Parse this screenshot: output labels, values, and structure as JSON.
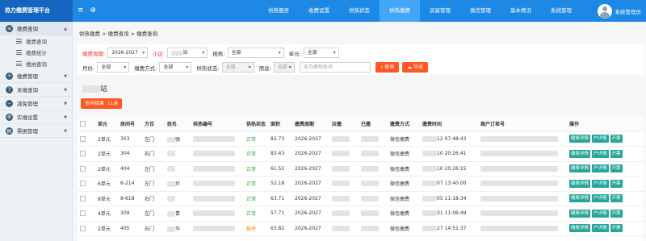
{
  "app": {
    "title": "热力缴费管理平台",
    "user": "系统管理员"
  },
  "topnav": [
    "供热服务",
    "收费设置",
    "供热状态",
    "供热缴费",
    "房屋管理",
    "微信管理",
    "基本情况",
    "系统管理"
  ],
  "topnav_active": 3,
  "sidebar": {
    "sections": [
      {
        "label": "缴费查询",
        "icon": "list-icon",
        "active": true
      },
      {
        "label": "缴费管理",
        "icon": "plus-icon"
      },
      {
        "label": "未缴查询",
        "icon": "search-icon"
      },
      {
        "label": "减免管理",
        "icon": "minus-icon"
      },
      {
        "label": "实缴设置",
        "icon": "settings-icon"
      },
      {
        "label": "票据管理",
        "icon": "doc-icon"
      }
    ],
    "subitems": [
      "缴费查询",
      "缴费统计",
      "缴纳查询"
    ]
  },
  "breadcrumb": "供热缴费 > 缴费查询 > 缴费查询",
  "filters": {
    "period_label": "缴费周期:",
    "period_value": "2026-2027",
    "district_label": "小区:",
    "district_value": "站",
    "building_label": "楼栋:",
    "building_value": "全部",
    "unit_label": "单元:",
    "unit_value": "全部",
    "month_label": "月份:",
    "month_value": "全部",
    "method_label": "缴费方式:",
    "method_value": "全部",
    "heat_label": "供热状态:",
    "heat_value": "全部",
    "usage_label": "用途:",
    "usage_value": "全部",
    "search_placeholder": "支持模糊查询",
    "query_btn": "查询",
    "export_btn": "导出"
  },
  "station_title": "站",
  "result_label": "查询结果",
  "result_count": "11条",
  "table": {
    "headers": [
      "单元",
      "房间号",
      "方位",
      "姓名",
      "供热编号",
      "供热状态",
      "面积",
      "缴费周期",
      "应缴",
      "已缴",
      "缴费方式",
      "缴费时间",
      "商户订单号",
      "操作"
    ],
    "rows": [
      {
        "unit": "2单元",
        "room": "303",
        "dir": "左门",
        "name": "强",
        "status": "正常",
        "status_type": "ok",
        "area": "82.73",
        "period": "2026-2027",
        "method": "微信缴费",
        "time": "12 07:48:43"
      },
      {
        "unit": "2单元",
        "room": "304",
        "dir": "右门",
        "name": "",
        "status": "正常",
        "status_type": "ok",
        "area": "83.43",
        "period": "2026-2027",
        "method": "微信缴费",
        "time": "10 20:26:41"
      },
      {
        "unit": "2单元",
        "room": "404",
        "dir": "左门",
        "name": "",
        "status": "正常",
        "status_type": "ok",
        "area": "61.52",
        "period": "2026-2027",
        "method": "微信缴费",
        "time": "10 20:26:15"
      },
      {
        "unit": "6单元",
        "room": "6-214",
        "dir": "左门",
        "name": "玲",
        "status": "正常",
        "status_type": "ok",
        "area": "52.18",
        "period": "2026-2027",
        "method": "微信缴费",
        "time": "07 13:40:00"
      },
      {
        "unit": "8单元",
        "room": "8-618",
        "dir": "右门",
        "name": "",
        "status": "正常",
        "status_type": "ok",
        "area": "63.71",
        "period": "2026-2027",
        "method": "微信缴费",
        "time": "05 11:18:34"
      },
      {
        "unit": "4单元",
        "room": "309",
        "dir": "左门",
        "name": "青",
        "status": "正常",
        "status_type": "ok",
        "area": "57.71",
        "period": "2026-2027",
        "method": "微信缴费",
        "time": "31 11:06:49"
      },
      {
        "unit": "2单元",
        "room": "405",
        "dir": "右门",
        "name": "华",
        "status": "报停",
        "status_type": "warn",
        "area": "63.82",
        "period": "2026-2027",
        "method": "微信缴费",
        "time": "27 14:51:37"
      }
    ],
    "ops": [
      "缴费详情",
      "户详情",
      "开票"
    ]
  },
  "colors": {
    "topbar": "#1e88e5",
    "accent_orange": "#ff5722",
    "status_ok": "#43a047",
    "status_warn": "#fb8c00",
    "op_button": "#26a69a"
  }
}
